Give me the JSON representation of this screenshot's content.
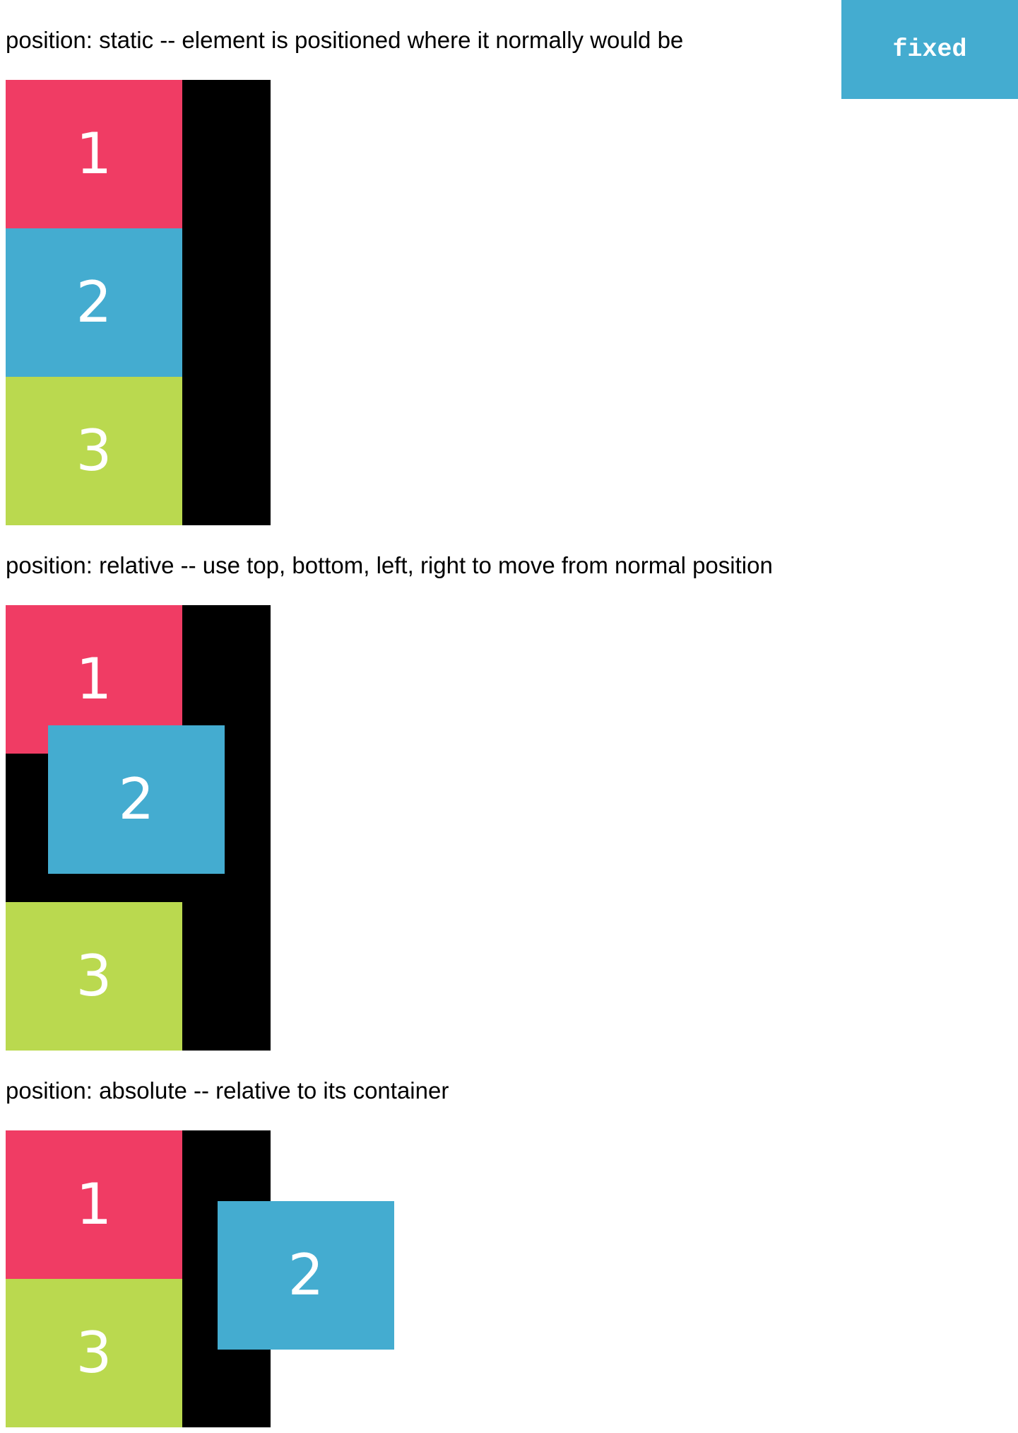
{
  "colors": {
    "red": "#f03c64",
    "blue": "#44acd0",
    "green": "#bad94f",
    "container": "#000000"
  },
  "fixed_label": "fixed",
  "sections": [
    {
      "heading": "position: static -- element is positioned where it normally would be",
      "boxes": [
        "1",
        "2",
        "3"
      ]
    },
    {
      "heading": "position: relative -- use top, bottom, left, right to move from normal position",
      "boxes": [
        "1",
        "2",
        "3"
      ]
    },
    {
      "heading": "position: absolute -- relative to its container",
      "boxes": [
        "1",
        "2",
        "3"
      ]
    }
  ]
}
